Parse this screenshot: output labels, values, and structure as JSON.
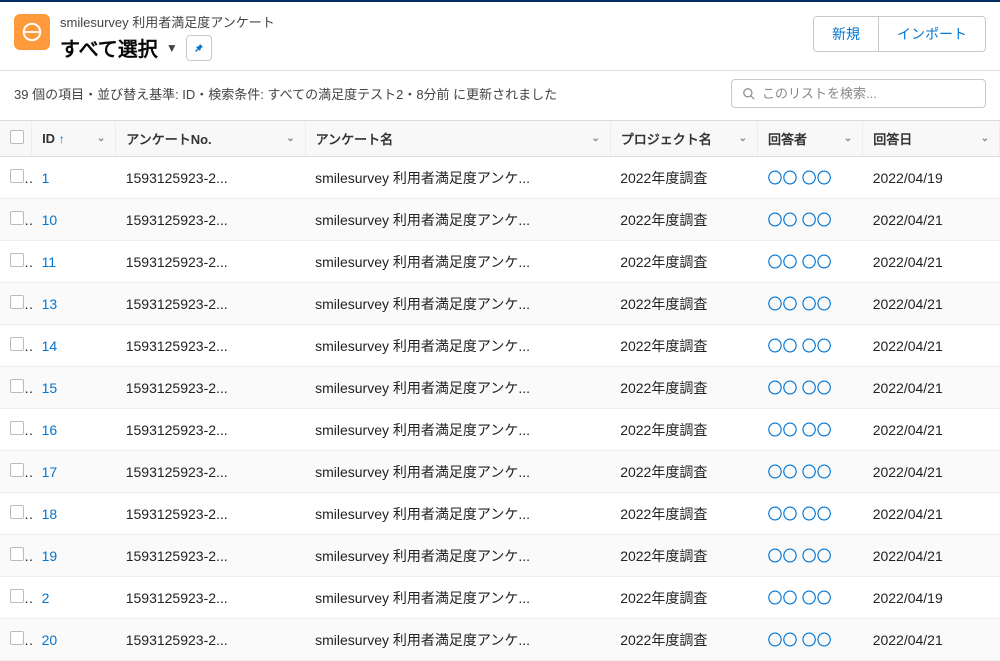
{
  "header": {
    "subtitle": "smilesurvey 利用者満足度アンケート",
    "title": "すべて選択",
    "btn_new": "新規",
    "btn_import": "インポート"
  },
  "status": {
    "text": "39 個の項目・並び替え基準: ID・検索条件: すべての満足度テスト2・8分前 に更新されました"
  },
  "search": {
    "placeholder": "このリストを検索..."
  },
  "columns": {
    "id": "ID",
    "no": "アンケートNo.",
    "name": "アンケート名",
    "project": "プロジェクト名",
    "respondent": "回答者",
    "date": "回答日"
  },
  "rows": [
    {
      "id": "1",
      "no": "1593125923-2...",
      "name": "smilesurvey 利用者満足度アンケ...",
      "project": "2022年度調査",
      "respondent": "〇〇 〇〇",
      "date": "2022/04/19"
    },
    {
      "id": "10",
      "no": "1593125923-2...",
      "name": "smilesurvey 利用者満足度アンケ...",
      "project": "2022年度調査",
      "respondent": "〇〇 〇〇",
      "date": "2022/04/21"
    },
    {
      "id": "11",
      "no": "1593125923-2...",
      "name": "smilesurvey 利用者満足度アンケ...",
      "project": "2022年度調査",
      "respondent": "〇〇 〇〇",
      "date": "2022/04/21"
    },
    {
      "id": "13",
      "no": "1593125923-2...",
      "name": "smilesurvey 利用者満足度アンケ...",
      "project": "2022年度調査",
      "respondent": "〇〇 〇〇",
      "date": "2022/04/21"
    },
    {
      "id": "14",
      "no": "1593125923-2...",
      "name": "smilesurvey 利用者満足度アンケ...",
      "project": "2022年度調査",
      "respondent": "〇〇 〇〇",
      "date": "2022/04/21"
    },
    {
      "id": "15",
      "no": "1593125923-2...",
      "name": "smilesurvey 利用者満足度アンケ...",
      "project": "2022年度調査",
      "respondent": "〇〇 〇〇",
      "date": "2022/04/21"
    },
    {
      "id": "16",
      "no": "1593125923-2...",
      "name": "smilesurvey 利用者満足度アンケ...",
      "project": "2022年度調査",
      "respondent": "〇〇 〇〇",
      "date": "2022/04/21"
    },
    {
      "id": "17",
      "no": "1593125923-2...",
      "name": "smilesurvey 利用者満足度アンケ...",
      "project": "2022年度調査",
      "respondent": "〇〇 〇〇",
      "date": "2022/04/21"
    },
    {
      "id": "18",
      "no": "1593125923-2...",
      "name": "smilesurvey 利用者満足度アンケ...",
      "project": "2022年度調査",
      "respondent": "〇〇 〇〇",
      "date": "2022/04/21"
    },
    {
      "id": "19",
      "no": "1593125923-2...",
      "name": "smilesurvey 利用者満足度アンケ...",
      "project": "2022年度調査",
      "respondent": "〇〇 〇〇",
      "date": "2022/04/21"
    },
    {
      "id": "2",
      "no": "1593125923-2...",
      "name": "smilesurvey 利用者満足度アンケ...",
      "project": "2022年度調査",
      "respondent": "〇〇 〇〇",
      "date": "2022/04/19"
    },
    {
      "id": "20",
      "no": "1593125923-2...",
      "name": "smilesurvey 利用者満足度アンケ...",
      "project": "2022年度調査",
      "respondent": "〇〇 〇〇",
      "date": "2022/04/21"
    }
  ]
}
